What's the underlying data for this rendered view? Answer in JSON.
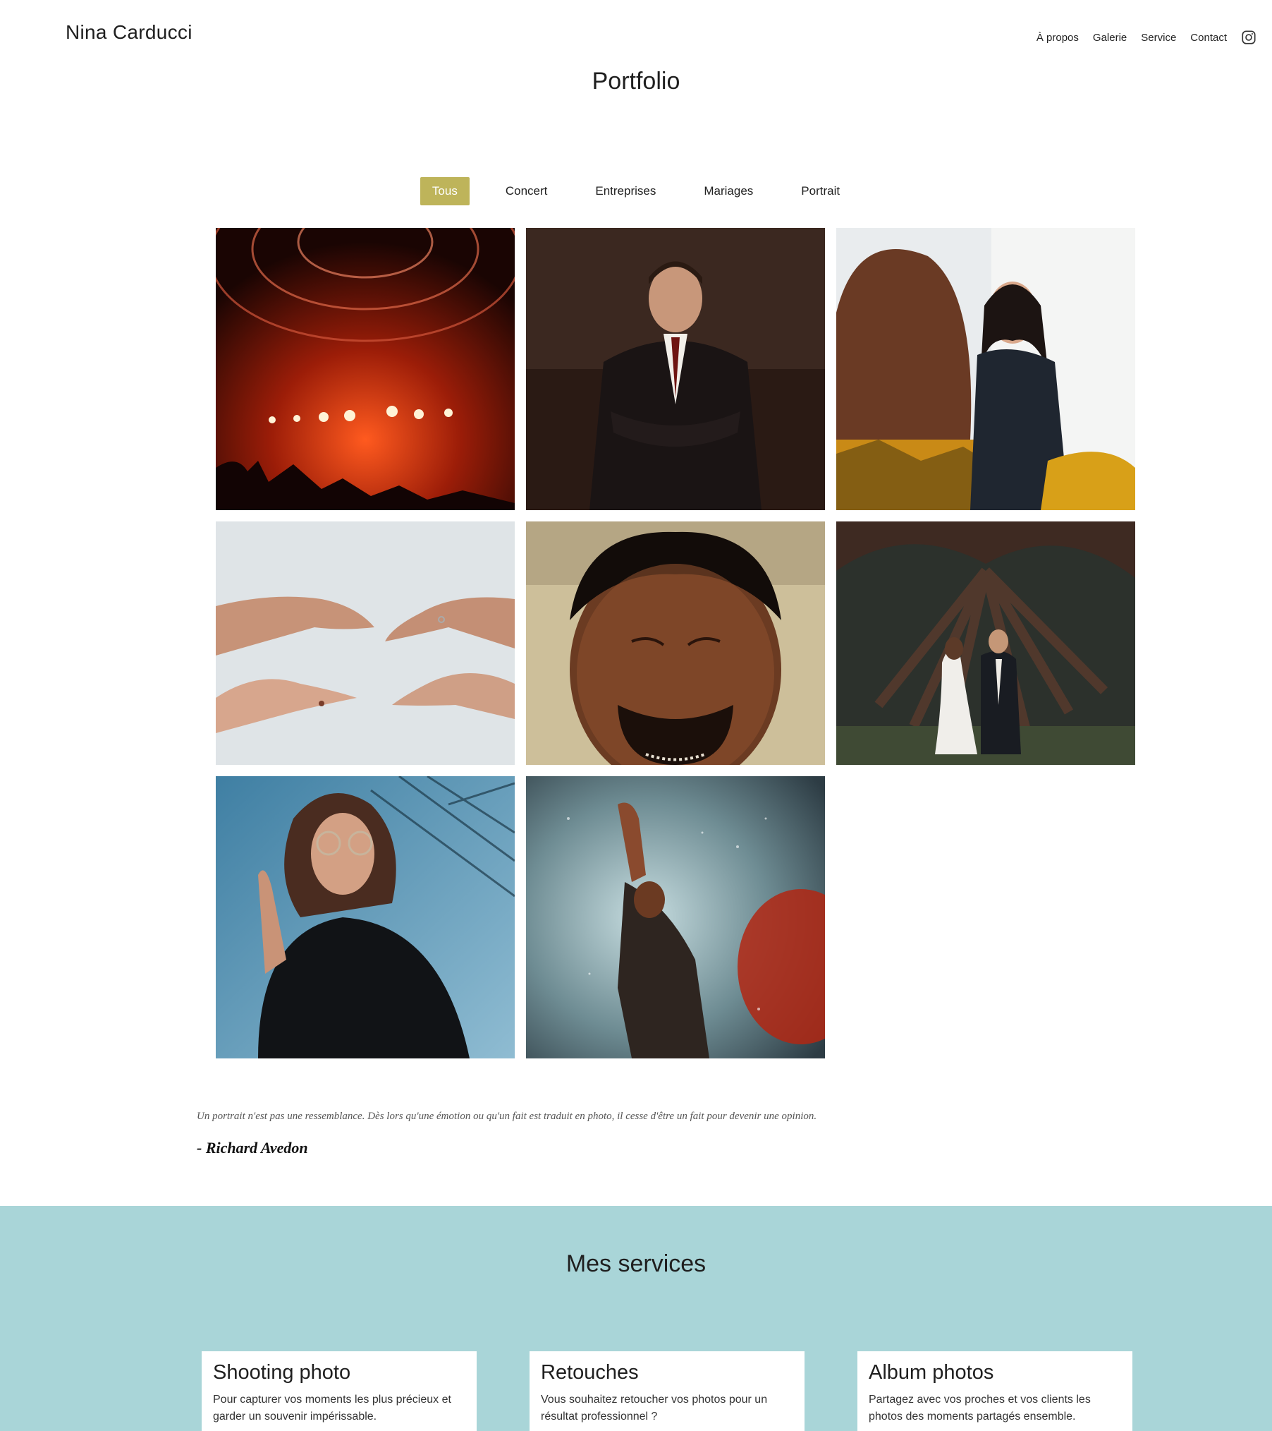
{
  "header": {
    "brand": "Nina Carducci",
    "nav": [
      {
        "label": "À propos"
      },
      {
        "label": "Galerie"
      },
      {
        "label": "Service"
      },
      {
        "label": "Contact"
      }
    ],
    "social_icon": "instagram-icon"
  },
  "portfolio": {
    "title": "Portfolio",
    "filters": [
      {
        "label": "Tous",
        "active": true
      },
      {
        "label": "Concert",
        "active": false
      },
      {
        "label": "Entreprises",
        "active": false
      },
      {
        "label": "Mariages",
        "active": false
      },
      {
        "label": "Portrait",
        "active": false
      }
    ],
    "active_color": "#beb45a"
  },
  "quote": {
    "text": "Un portrait n'est pas une ressemblance. Dès lors qu'une émotion ou qu'un fait est traduit en photo, il cesse d'être un fait pour devenir une opinion.",
    "author": "- Richard Avedon"
  },
  "services": {
    "title": "Mes services",
    "background_color": "#a9d5d8",
    "cards": [
      {
        "title": "Shooting photo",
        "text": "Pour capturer vos moments les plus précieux et garder un souvenir impérissable."
      },
      {
        "title": "Retouches",
        "text": "Vous souhaitez retoucher vos photos pour un résultat professionnel ?"
      },
      {
        "title": "Album photos",
        "text": "Partagez avec vos proches et vos clients les photos des moments partagés ensemble."
      }
    ]
  }
}
